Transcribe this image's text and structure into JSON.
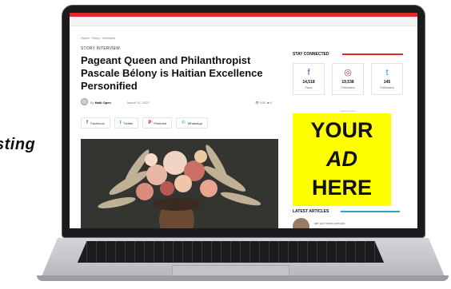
{
  "side_text": "sting",
  "article": {
    "breadcrumb": "Home › Story › Interview",
    "kicker": "STORY INTERVIEW",
    "headline": "Pageant Queen and Philanthropist Pascale Bélony is Haitian Excellence Personified",
    "byline_prefix": "By",
    "author": "Haiti Open",
    "date": "March 31, 2022",
    "views": "690",
    "comments": "0",
    "share_buttons": [
      {
        "icon": "f",
        "label": "Facebook",
        "color": "#3b5998"
      },
      {
        "icon": "t",
        "label": "Twitter",
        "color": "#1da1f2"
      },
      {
        "icon": "P",
        "label": "Pinterest",
        "color": "#e60023"
      },
      {
        "icon": "©",
        "label": "WhatsApp",
        "color": "#25d366"
      }
    ]
  },
  "sidebar": {
    "stay_connected": "STAY CONNECTED",
    "social": [
      {
        "icon": "f",
        "count": "14,518",
        "label": "Fans",
        "color": "#3b5998"
      },
      {
        "icon": "◎",
        "count": "19,538",
        "label": "Followers",
        "color": "#c13584"
      },
      {
        "icon": "t",
        "count": "145",
        "label": "Followers",
        "color": "#1da1f2"
      }
    ],
    "ad_label": "- Advertisement -",
    "ad_lines": [
      "YOUR",
      "AD",
      "HERE"
    ],
    "latest_articles": "LATEST ARTICLES",
    "latest_item_title": "HBT 100 YOUNG HAITIANS"
  },
  "colors": {
    "accent_red": "#e1262c",
    "accent_teal": "#2ba9b9",
    "ad_yellow": "#ffff00"
  }
}
